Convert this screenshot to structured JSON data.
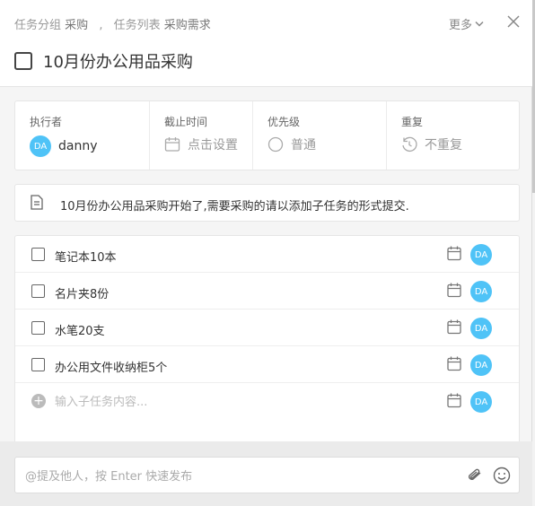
{
  "breadcrumb": {
    "group_label": "任务分组",
    "group_value": "采购",
    "separator": ",",
    "list_label": "任务列表",
    "list_value": "采购需求"
  },
  "header": {
    "more_label": "更多",
    "title": "10月份办公用品采购"
  },
  "meta": {
    "assignee": {
      "label": "执行者",
      "avatar": "DA",
      "value": "danny"
    },
    "deadline": {
      "label": "截止时间",
      "value": "点击设置"
    },
    "priority": {
      "label": "优先级",
      "value": "普通"
    },
    "repeat": {
      "label": "重复",
      "value": "不重复"
    }
  },
  "description": "10月份办公用品采购开始了,需要采购的请以添加子任务的形式提交.",
  "subtasks": [
    {
      "text": "笔记本10本",
      "avatar": "DA"
    },
    {
      "text": "名片夹8份",
      "avatar": "DA"
    },
    {
      "text": "水笔20支",
      "avatar": "DA"
    },
    {
      "text": "办公用文件收纳柜5个",
      "avatar": "DA"
    }
  ],
  "new_subtask": {
    "placeholder": "输入子任务内容...",
    "avatar": "DA",
    "add_symbol": "+"
  },
  "comment": {
    "placeholder": "@提及他人，按 Enter 快速发布"
  },
  "colors": {
    "avatar_bg": "#4fc3f7",
    "panel_bg": "#f5f5f5"
  }
}
